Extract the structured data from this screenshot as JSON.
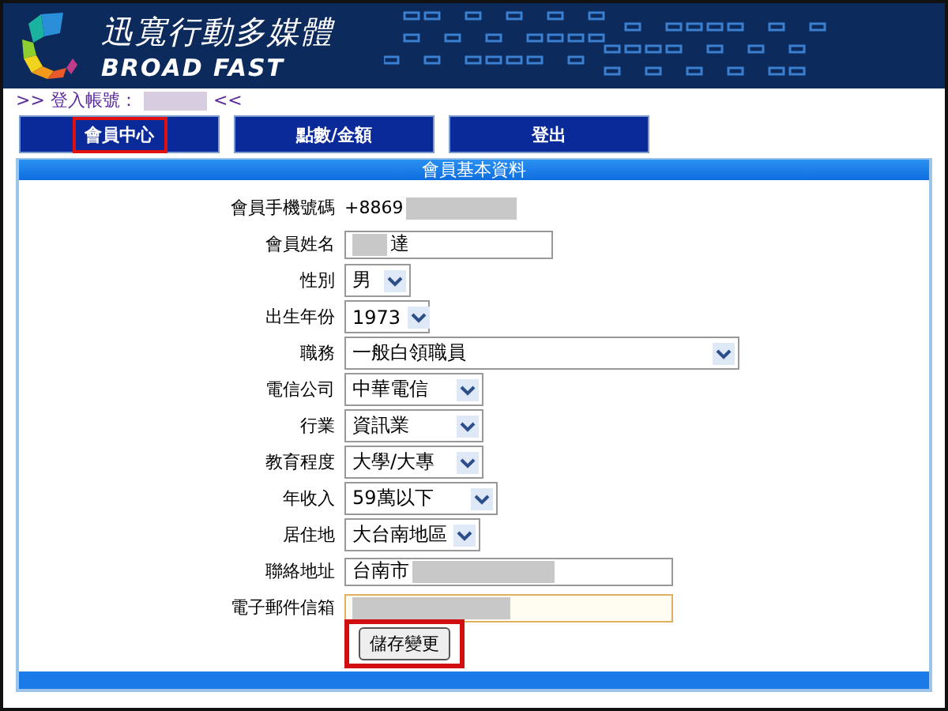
{
  "header": {
    "brand_cn": "迅寬行動多媒體",
    "brand_en": "BROAD FAST"
  },
  "login": {
    "prefix": ">> 登入帳號：",
    "suffix": "<<"
  },
  "tabs": [
    {
      "label": "會員中心",
      "highlighted": true
    },
    {
      "label": "點數/金額",
      "highlighted": false
    },
    {
      "label": "登出",
      "highlighted": false
    }
  ],
  "section": {
    "title": "會員基本資料"
  },
  "fields": [
    {
      "kind": "static",
      "label": "會員手機號碼",
      "value": "+8869",
      "redacted": true
    },
    {
      "kind": "text",
      "label": "會員姓名",
      "value": "達",
      "redacted": true,
      "focused": false
    },
    {
      "kind": "select",
      "label": "性別",
      "value": "男"
    },
    {
      "kind": "select",
      "label": "出生年份",
      "value": "1973"
    },
    {
      "kind": "select",
      "label": "職務",
      "value": "一般白領職員"
    },
    {
      "kind": "select",
      "label": "電信公司",
      "value": "中華電信"
    },
    {
      "kind": "select",
      "label": "行業",
      "value": "資訊業"
    },
    {
      "kind": "select",
      "label": "教育程度",
      "value": "大學/大專"
    },
    {
      "kind": "select",
      "label": "年收入",
      "value": "59萬以下"
    },
    {
      "kind": "select",
      "label": "居住地",
      "value": "大台南地區"
    },
    {
      "kind": "text",
      "label": "聯絡地址",
      "value": "台南市",
      "redacted": true,
      "focused": false
    },
    {
      "kind": "text",
      "label": "電子郵件信箱",
      "redacted": true,
      "focused": true
    }
  ],
  "save_button": {
    "label": "儲存變更",
    "highlighted": true
  }
}
